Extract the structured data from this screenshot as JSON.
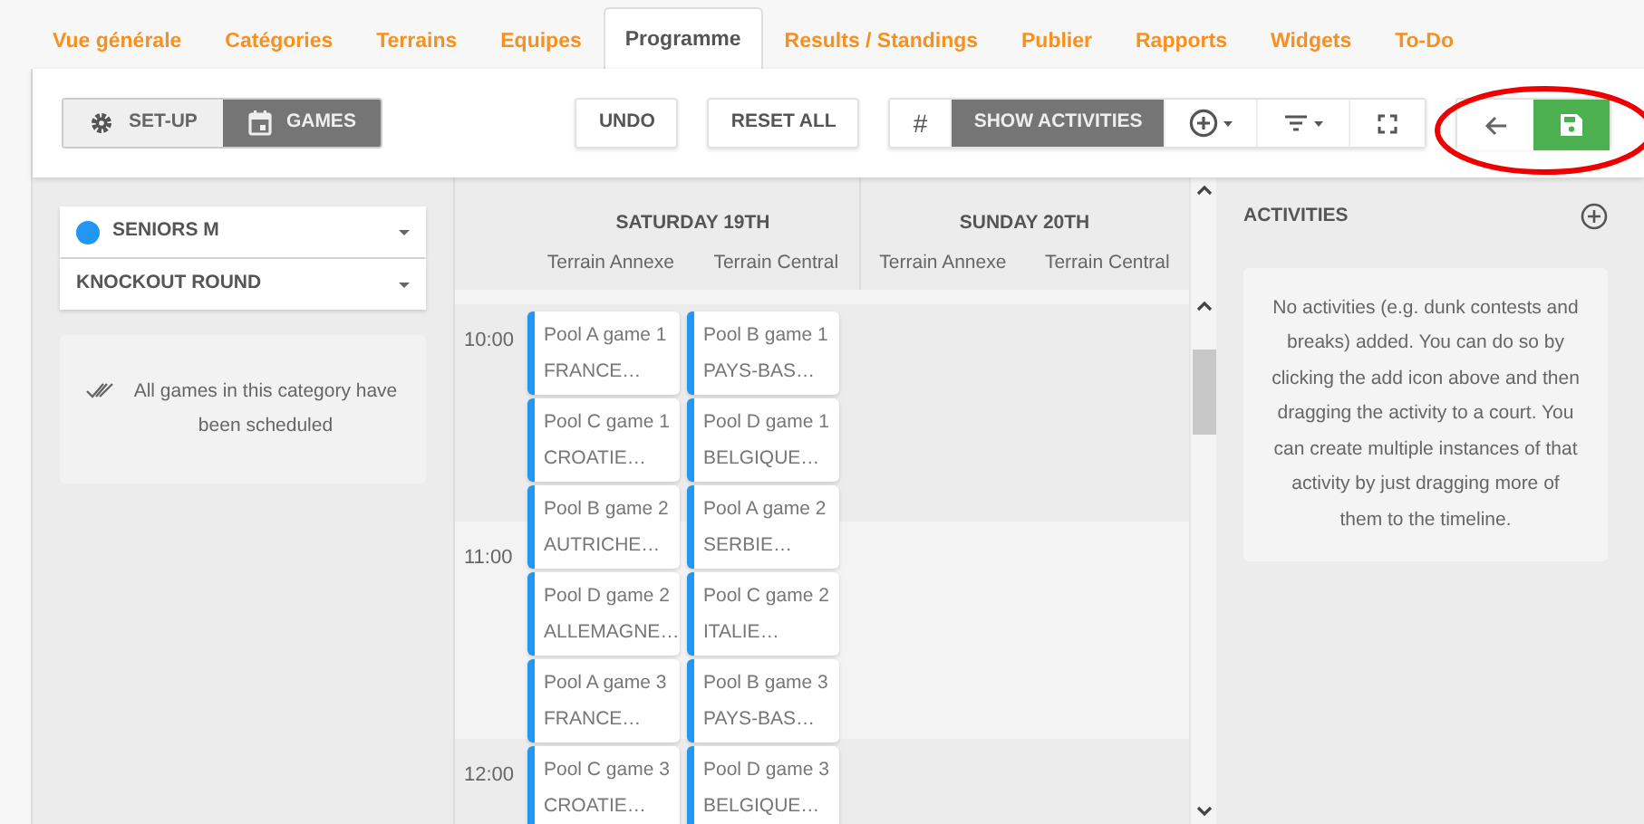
{
  "tabs": [
    {
      "label": "Vue générale",
      "selected": false
    },
    {
      "label": "Catégories",
      "selected": false
    },
    {
      "label": "Terrains",
      "selected": false
    },
    {
      "label": "Equipes",
      "selected": false
    },
    {
      "label": "Programme",
      "selected": true
    },
    {
      "label": "Results / Standings",
      "selected": false
    },
    {
      "label": "Publier",
      "selected": false
    },
    {
      "label": "Rapports",
      "selected": false
    },
    {
      "label": "Widgets",
      "selected": false
    },
    {
      "label": "To-Do",
      "selected": false
    }
  ],
  "toolbar": {
    "mode_toggle": [
      {
        "label": "SET-UP",
        "kind": "gear",
        "selected": false
      },
      {
        "label": "GAMES",
        "kind": "calendar",
        "selected": true
      }
    ],
    "undo": "UNDO",
    "reset": "RESET ALL",
    "view_group": [
      {
        "kind": "text",
        "label": "#",
        "selected": false
      },
      {
        "kind": "text",
        "label": "SHOW ACTIVITIES",
        "selected": true
      },
      {
        "kind": "add-dropdown"
      },
      {
        "kind": "filter-dropdown"
      },
      {
        "kind": "fullscreen"
      }
    ],
    "nav_group": {
      "highlighted": true,
      "buttons": [
        {
          "kind": "back"
        },
        {
          "kind": "save"
        }
      ]
    }
  },
  "sidebar": {
    "category": {
      "label": "SENIORS M",
      "color": "#2196f3"
    },
    "round": {
      "label": "KNOCKOUT ROUND"
    },
    "notice": "All games in this category have been scheduled"
  },
  "schedule": {
    "times": [
      "10:00",
      "11:00",
      "12:00"
    ],
    "days": [
      {
        "label": "SATURDAY 19TH",
        "courts": [
          {
            "name": "Terrain Annexe",
            "games": [
              {
                "title": "Pool A game 1",
                "team": "FRANCE…"
              },
              {
                "title": "Pool C game 1",
                "team": "CROATIE…"
              },
              {
                "title": "Pool B game 2",
                "team": "AUTRICHE…"
              },
              {
                "title": "Pool D game 2",
                "team": "ALLEMAGNE…"
              },
              {
                "title": "Pool A game 3",
                "team": "FRANCE…"
              },
              {
                "title": "Pool C game 3",
                "team": "CROATIE…"
              }
            ]
          },
          {
            "name": "Terrain Central",
            "games": [
              {
                "title": "Pool B game 1",
                "team": "PAYS-BAS…"
              },
              {
                "title": "Pool D game 1",
                "team": "BELGIQUE…"
              },
              {
                "title": "Pool A game 2",
                "team": "SERBIE…"
              },
              {
                "title": "Pool C game 2",
                "team": "ITALIE…"
              },
              {
                "title": "Pool B game 3",
                "team": "PAYS-BAS…"
              },
              {
                "title": "Pool D game 3",
                "team": "BELGIQUE…"
              }
            ]
          }
        ]
      },
      {
        "label": "SUNDAY 20TH",
        "courts": [
          {
            "name": "Terrain Annexe"
          },
          {
            "name": "Terrain Central"
          }
        ]
      }
    ]
  },
  "activities": {
    "title": "ACTIVITIES",
    "empty_text": "No activities (e.g. dunk contests and breaks) added. You can do so by clicking the add icon above and then dragging the activity to a court. You can create multiple instances of that activity by just dragging more of them to the timeline."
  }
}
